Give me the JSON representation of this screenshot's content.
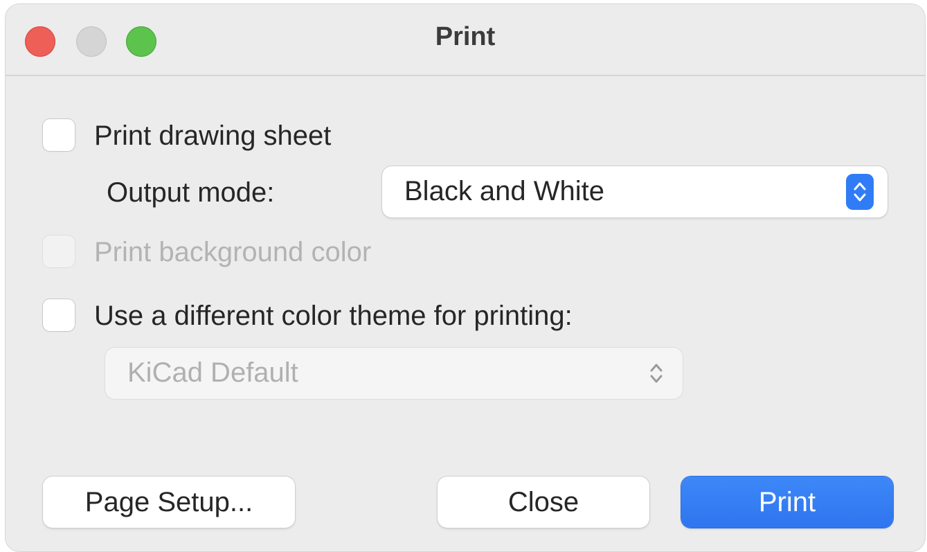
{
  "window": {
    "title": "Print"
  },
  "options": {
    "print_drawing_sheet": {
      "label": "Print drawing sheet",
      "checked": false
    },
    "output_mode": {
      "label": "Output mode:",
      "value": "Black and White"
    },
    "print_background_color": {
      "label": "Print background color",
      "checked": false,
      "enabled": false
    },
    "different_theme": {
      "label": "Use a different color theme for printing:",
      "checked": false
    },
    "theme_select": {
      "value": "KiCad Default",
      "enabled": false
    }
  },
  "buttons": {
    "page_setup": "Page Setup...",
    "close": "Close",
    "print": "Print"
  },
  "colors": {
    "accent": "#2f7cf6",
    "close_light": "#ee5f57",
    "minimize_light": "#d5d5d5",
    "zoom_light": "#5cc34d"
  }
}
